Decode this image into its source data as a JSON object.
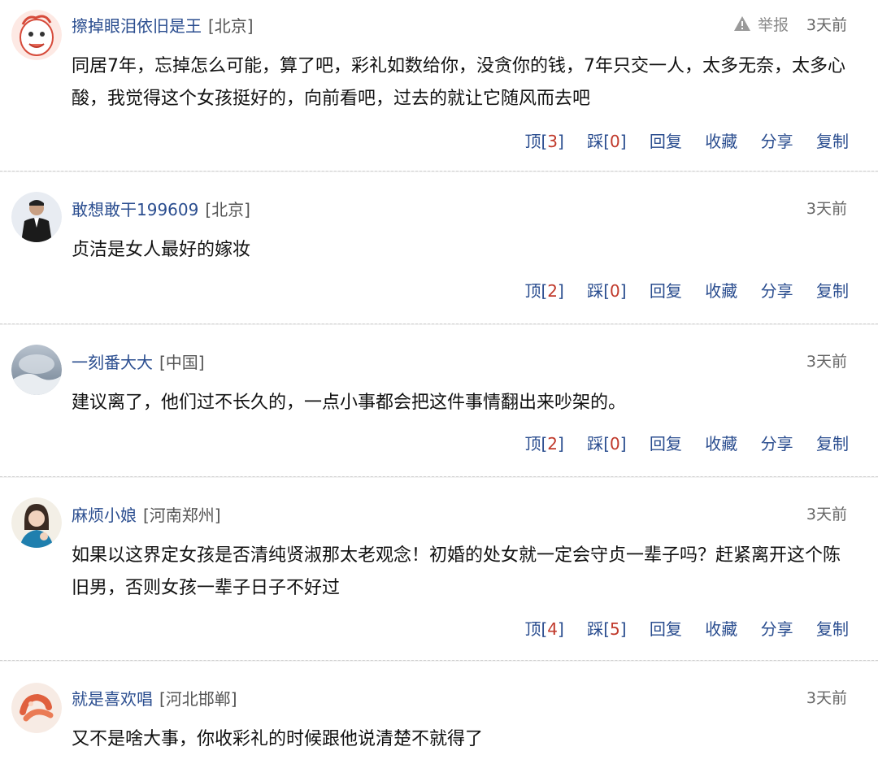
{
  "comments": [
    {
      "username": "擦掉眼泪依旧是王",
      "location": "[北京]",
      "report": "举报",
      "time": "3天前",
      "content": "同居7年，忘掉怎么可能，算了吧，彩礼如数给你，没贪你的钱，7年只交一人，太多无奈，太多心酸，我觉得这个女孩挺好的，向前看吧，过去的就让它随风而去吧",
      "up_label": "顶",
      "up_count": "3",
      "down_label": "踩",
      "down_count": "0",
      "reply": "回复",
      "favorite": "收藏",
      "share": "分享",
      "copy": "复制"
    },
    {
      "username": "敢想敢干199609",
      "location": "[北京]",
      "time": "3天前",
      "content": "贞洁是女人最好的嫁妆",
      "up_label": "顶",
      "up_count": "2",
      "down_label": "踩",
      "down_count": "0",
      "reply": "回复",
      "favorite": "收藏",
      "share": "分享",
      "copy": "复制"
    },
    {
      "username": "一刻番大大",
      "location": "[中国]",
      "time": "3天前",
      "content": "建议离了，他们过不长久的，一点小事都会把这件事情翻出来吵架的。",
      "up_label": "顶",
      "up_count": "2",
      "down_label": "踩",
      "down_count": "0",
      "reply": "回复",
      "favorite": "收藏",
      "share": "分享",
      "copy": "复制"
    },
    {
      "username": "麻烦小娘",
      "location": "[河南郑州]",
      "time": "3天前",
      "content": "如果以这界定女孩是否清纯贤淑那太老观念！初婚的处女就一定会守贞一辈子吗？赶紧离开这个陈旧男，否则女孩一辈子日子不好过",
      "up_label": "顶",
      "up_count": "4",
      "down_label": "踩",
      "down_count": "5",
      "reply": "回复",
      "favorite": "收藏",
      "share": "分享",
      "copy": "复制"
    },
    {
      "username": "就是喜欢唱",
      "location": "[河北邯郸]",
      "time": "3天前",
      "content": "又不是啥大事，你收彩礼的时候跟他说清楚不就得了"
    }
  ],
  "colors": {
    "username": "#2a4d8f",
    "count": "#c0392b",
    "divider": "#cfcfcf"
  }
}
